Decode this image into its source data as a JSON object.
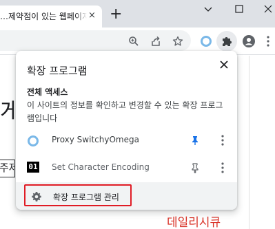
{
  "tab": {
    "title": "…제약점이 있는 웹페이지",
    "close_glyph": "×"
  },
  "new_tab": {
    "glyph": "+"
  },
  "page": {
    "big_text": "게시",
    "input_text": "주제",
    "bottom_text": "데일리시큐"
  },
  "popup": {
    "title": "확장 프로그램",
    "section_heading": "전체 액세스",
    "section_desc": "이 사이트의 정보를 확인하고 변경할 수 있는 확장 프로그램입니다",
    "extensions": [
      {
        "name": "Proxy SwitchyOmega",
        "icon": "proxy-switchyomega-icon",
        "pinned": true
      },
      {
        "name": "Set Character Encoding",
        "icon": "set-character-encoding-icon",
        "logo_text": "01",
        "pinned": false
      }
    ],
    "manage_label": "확장 프로그램 관리"
  },
  "colors": {
    "tabstrip": "#dee1e6",
    "pin_active": "#1a73e8",
    "highlight": "#e01b24",
    "bottom_text": "#d93025"
  }
}
